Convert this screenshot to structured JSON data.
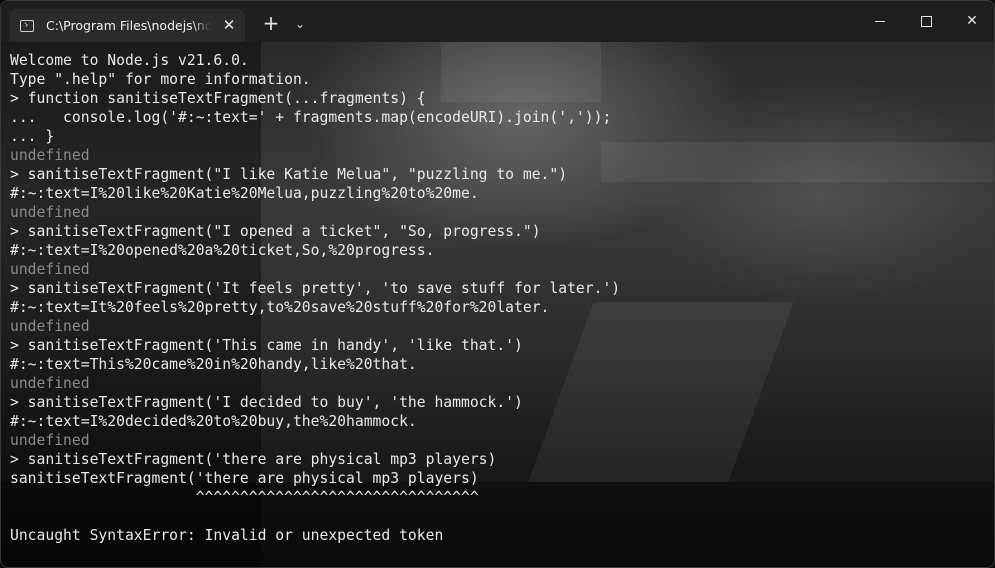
{
  "tab": {
    "title": "C:\\Program Files\\nodejs\\node.exe",
    "close_glyph": "✕"
  },
  "titlebar": {
    "new_tab_glyph": "+",
    "dropdown_glyph": "⌄",
    "close_glyph": "✕"
  },
  "terminal": {
    "lines": [
      {
        "text": "Welcome to Node.js v21.6.0.",
        "style": "normal"
      },
      {
        "text": "Type \".help\" for more information.",
        "style": "normal"
      },
      {
        "text": "> function sanitiseTextFragment(...fragments) {",
        "style": "normal"
      },
      {
        "text": "...   console.log('#:~:text=' + fragments.map(encodeURI).join(','));",
        "style": "normal"
      },
      {
        "text": "... }",
        "style": "normal"
      },
      {
        "text": "undefined",
        "style": "dim"
      },
      {
        "text": "> sanitiseTextFragment(\"I like Katie Melua\", \"puzzling to me.\")",
        "style": "normal"
      },
      {
        "text": "#:~:text=I%20like%20Katie%20Melua,puzzling%20to%20me.",
        "style": "normal"
      },
      {
        "text": "undefined",
        "style": "dim"
      },
      {
        "text": "> sanitiseTextFragment(\"I opened a ticket\", \"So, progress.\")",
        "style": "normal"
      },
      {
        "text": "#:~:text=I%20opened%20a%20ticket,So,%20progress.",
        "style": "normal"
      },
      {
        "text": "undefined",
        "style": "dim"
      },
      {
        "text": "> sanitiseTextFragment('It feels pretty', 'to save stuff for later.')",
        "style": "normal"
      },
      {
        "text": "#:~:text=It%20feels%20pretty,to%20save%20stuff%20for%20later.",
        "style": "normal"
      },
      {
        "text": "undefined",
        "style": "dim"
      },
      {
        "text": "> sanitiseTextFragment('This came in handy', 'like that.')",
        "style": "normal"
      },
      {
        "text": "#:~:text=This%20came%20in%20handy,like%20that.",
        "style": "normal"
      },
      {
        "text": "undefined",
        "style": "dim"
      },
      {
        "text": "> sanitiseTextFragment('I decided to buy', 'the hammock.')",
        "style": "normal"
      },
      {
        "text": "#:~:text=I%20decided%20to%20buy,the%20hammock.",
        "style": "normal"
      },
      {
        "text": "undefined",
        "style": "dim"
      },
      {
        "text": "> sanitiseTextFragment('there are physical mp3 players)",
        "style": "normal"
      },
      {
        "text": "sanitiseTextFragment('there are physical mp3 players)",
        "style": "normal"
      },
      {
        "text": "                     ^^^^^^^^^^^^^^^^^^^^^^^^^^^^^^^^",
        "style": "normal"
      },
      {
        "text": "",
        "style": "normal"
      },
      {
        "text": "Uncaught SyntaxError: Invalid or unexpected token",
        "style": "normal"
      }
    ]
  },
  "colors": {
    "text": "#e8e8e8",
    "dim_text": "#8a8a8a",
    "titlebar": "#1f1f1f",
    "active_tab": "#2b2b2b"
  }
}
